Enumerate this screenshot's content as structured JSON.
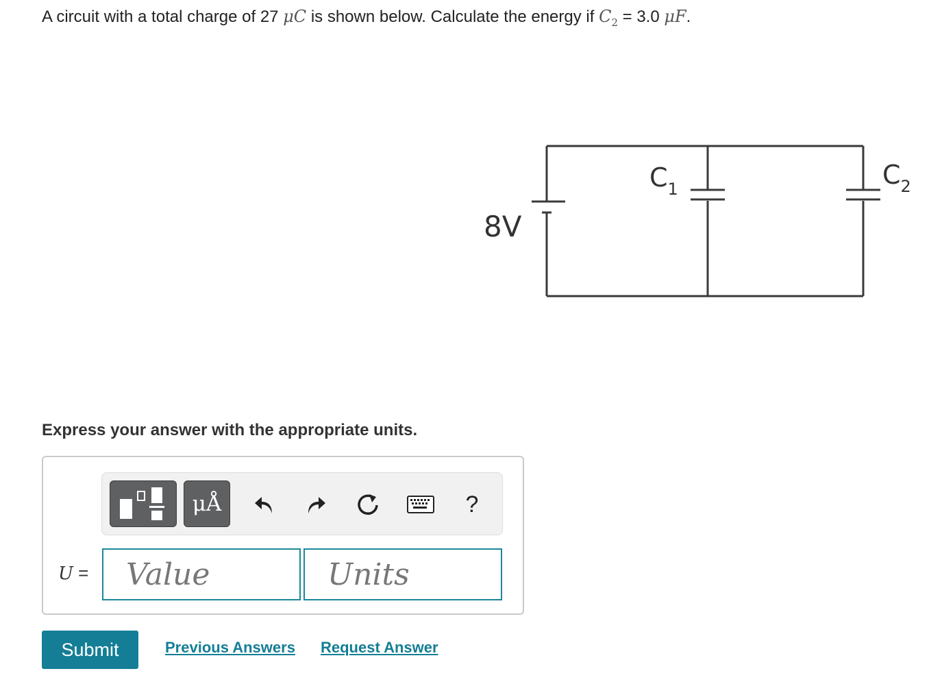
{
  "question": {
    "text_1": "A circuit with a total charge of 27 ",
    "charge_unit": "μC",
    "text_2": " is shown below. Calculate the energy if ",
    "cap_symbol": "C",
    "cap_subscript": "2",
    "text_3": " = 3.0 ",
    "cap_unit": "μF",
    "text_4": "."
  },
  "diagram": {
    "battery_label": "8V",
    "c1_label": "C",
    "c1_sub": "1",
    "c2_label": "C",
    "c2_sub": "2"
  },
  "instruction": "Express your answer with the appropriate units.",
  "toolbar": {
    "units_button_label": "μÅ",
    "help_label": "?"
  },
  "answer": {
    "variable": "U",
    "equals": " =",
    "value_placeholder": "Value",
    "units_placeholder": "Units"
  },
  "actions": {
    "submit_label": "Submit",
    "previous_answers_label": "Previous Answers",
    "request_answer_label": "Request Answer"
  },
  "colors": {
    "accent": "#137e96",
    "field_border": "#1a8797",
    "toolbar_button": "#5f6062"
  }
}
